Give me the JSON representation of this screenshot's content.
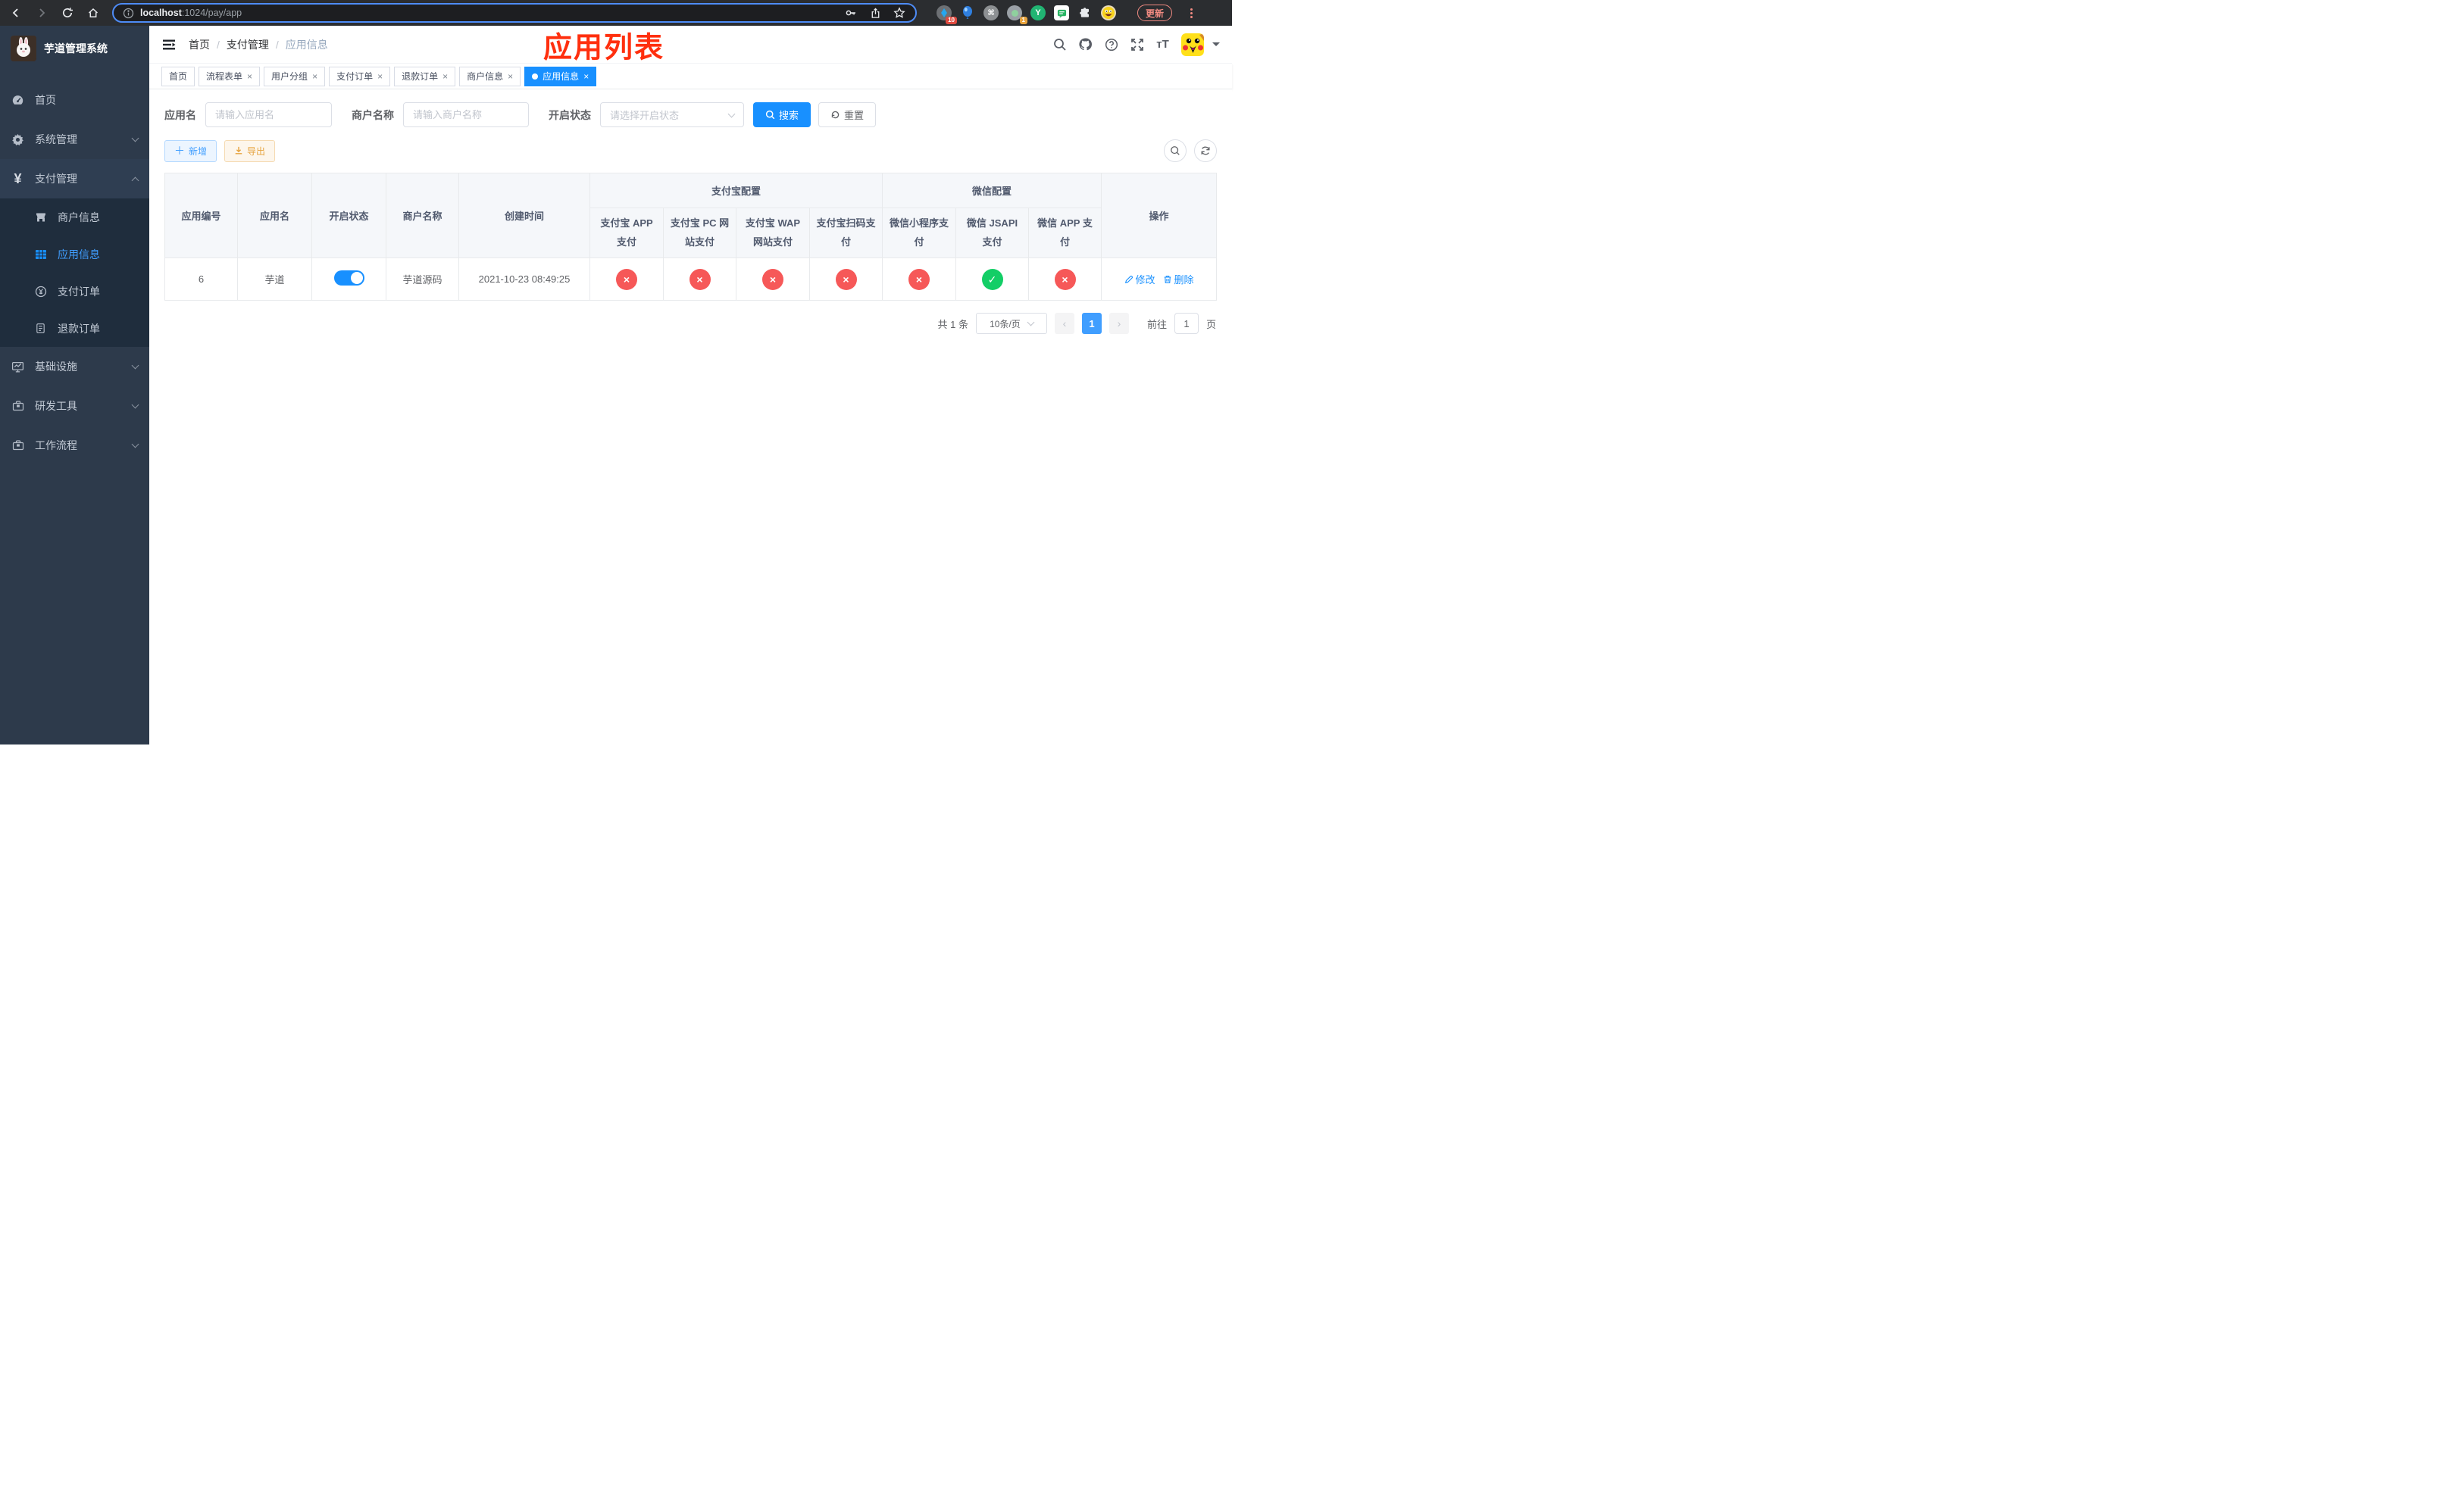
{
  "browser": {
    "url": {
      "host": "localhost",
      "rest": ":1024/pay/app"
    },
    "update_label": "更新",
    "ext_badge_a": "10",
    "ext_badge_b": "1",
    "ext_y_label": "Y"
  },
  "sidebar": {
    "title": "芋道管理系统",
    "menu": [
      {
        "label": "首页",
        "active": false
      },
      {
        "label": "系统管理",
        "active": false
      },
      {
        "label": "支付管理",
        "active": false
      },
      {
        "label": "商户信息",
        "active": false
      },
      {
        "label": "应用信息",
        "active": true
      },
      {
        "label": "支付订单",
        "active": false
      },
      {
        "label": "退款订单",
        "active": false
      },
      {
        "label": "基础设施",
        "active": false
      },
      {
        "label": "研发工具",
        "active": false
      },
      {
        "label": "工作流程",
        "active": false
      }
    ]
  },
  "navbar": {
    "breadcrumb": {
      "home": "首页",
      "section": "支付管理",
      "current": "应用信息"
    },
    "overlay_title": "应用列表"
  },
  "tags": [
    {
      "label": "首页",
      "closable": false,
      "active": false
    },
    {
      "label": "流程表单",
      "closable": true,
      "active": false
    },
    {
      "label": "用户分组",
      "closable": true,
      "active": false
    },
    {
      "label": "支付订单",
      "closable": true,
      "active": false
    },
    {
      "label": "退款订单",
      "closable": true,
      "active": false
    },
    {
      "label": "商户信息",
      "closable": true,
      "active": false
    },
    {
      "label": "应用信息",
      "closable": true,
      "active": true
    }
  ],
  "filters": {
    "app_name_label": "应用名",
    "app_name_placeholder": "请输入应用名",
    "merchant_label": "商户名称",
    "merchant_placeholder": "请输入商户名称",
    "status_label": "开启状态",
    "status_placeholder": "请选择开启状态",
    "search_label": "搜索",
    "reset_label": "重置"
  },
  "toolbar": {
    "add_label": "新增",
    "export_label": "导出"
  },
  "table": {
    "columns": {
      "app_id": "应用编号",
      "app_name": "应用名",
      "status": "开启状态",
      "merchant": "商户名称",
      "created": "创建时间",
      "alipay_group": "支付宝配置",
      "alipay": [
        "支付宝 APP 支付",
        "支付宝 PC 网站支付",
        "支付宝 WAP 网站支付",
        "支付宝扫码支付"
      ],
      "wechat_group": "微信配置",
      "wechat": [
        "微信小程序支付",
        "微信 JSAPI 支付",
        "微信 APP 支付"
      ],
      "actions": "操作"
    },
    "row": {
      "app_id": "6",
      "app_name": "芋道",
      "enabled": true,
      "merchant": "芋道源码",
      "created": "2021-10-23 08:49:25",
      "channel_status": [
        "no",
        "no",
        "no",
        "no",
        "no",
        "yes",
        "no"
      ],
      "edit_label": "修改",
      "delete_label": "删除"
    }
  },
  "pagination": {
    "total": "共 1 条",
    "page_size": "10条/页",
    "page": "1",
    "goto": "前往",
    "goto_value": "1",
    "unit": "页"
  },
  "colors": {
    "primary": "#1890ff",
    "success": "#13ce66",
    "danger": "#f65858",
    "warning": "#e6a23c",
    "annotation": "#ff2f0e"
  }
}
